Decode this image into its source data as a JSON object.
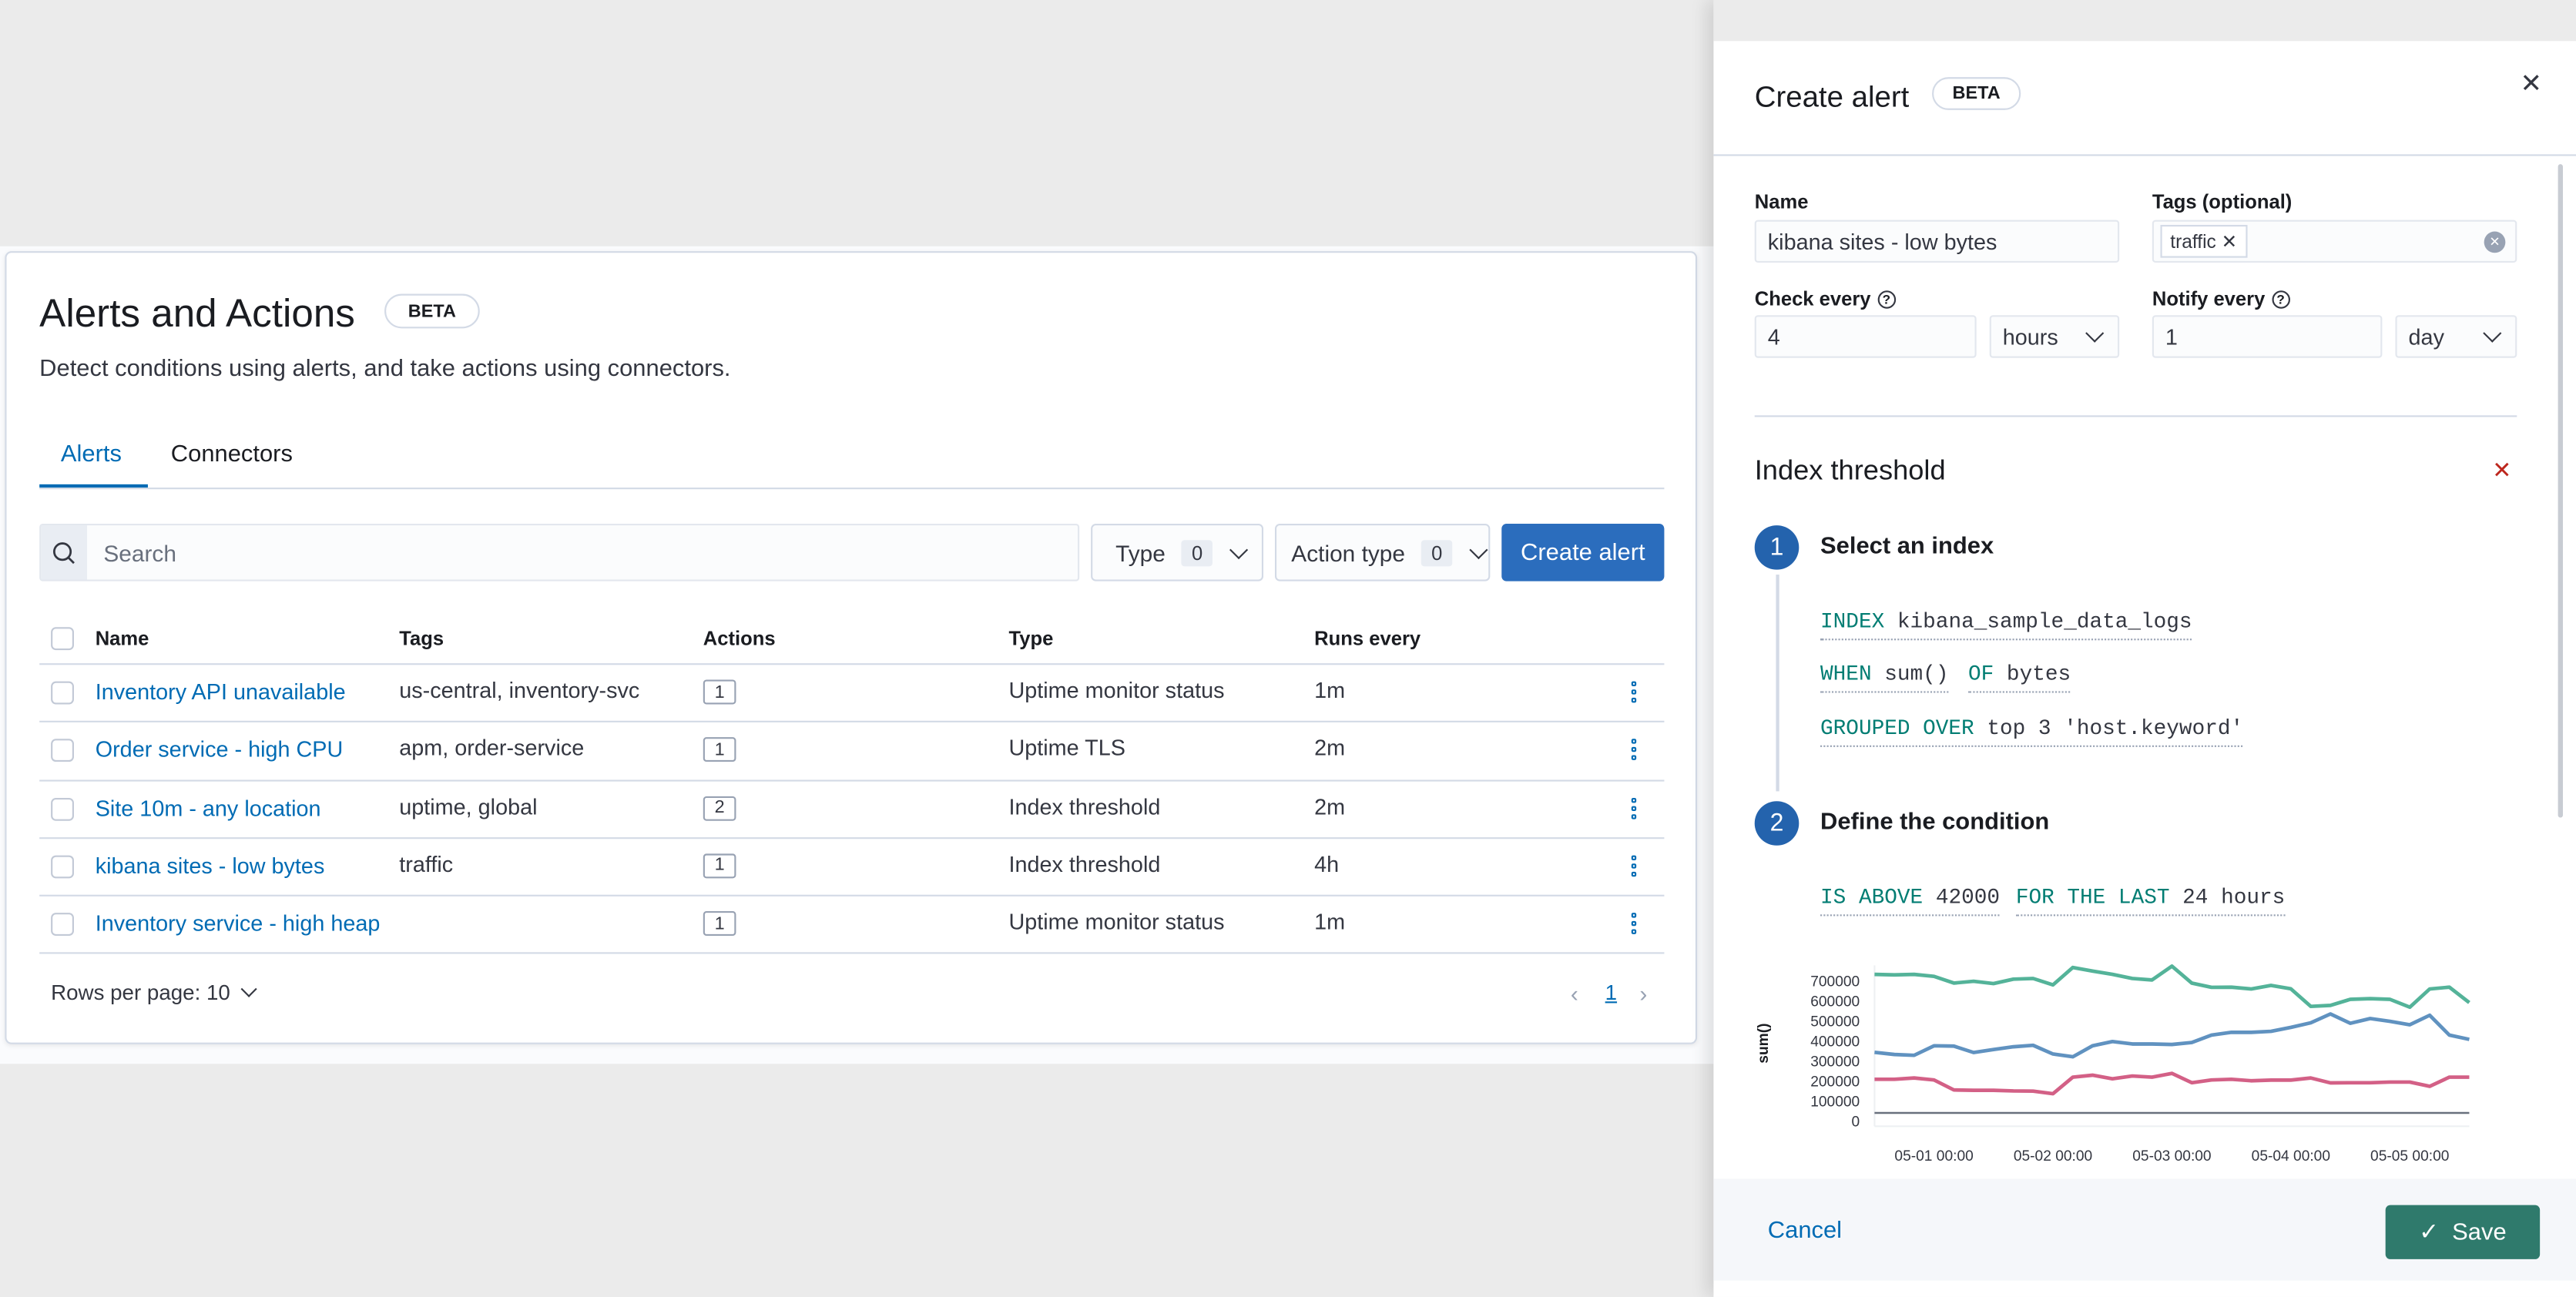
{
  "page": {
    "title": "Alerts and Actions",
    "badge": "BETA",
    "subtitle": "Detect conditions using alerts, and take actions using connectors.",
    "tabs": [
      {
        "label": "Alerts",
        "active": true
      },
      {
        "label": "Connectors",
        "active": false
      }
    ],
    "search_placeholder": "Search",
    "filters": [
      {
        "label": "Type",
        "count": "0"
      },
      {
        "label": "Action type",
        "count": "0"
      }
    ],
    "create_button": "Create alert",
    "columns": [
      "Name",
      "Tags",
      "Actions",
      "Type",
      "Runs every"
    ],
    "rows": [
      {
        "name": "Inventory API unavailable",
        "tags": "us-central, inventory-svc",
        "actions": "1",
        "type": "Uptime monitor status",
        "runs": "1m"
      },
      {
        "name": "Order service - high CPU",
        "tags": "apm, order-service",
        "actions": "1",
        "type": "Uptime TLS",
        "runs": "2m"
      },
      {
        "name": "Site 10m - any location",
        "tags": "uptime, global",
        "actions": "2",
        "type": "Index threshold",
        "runs": "2m"
      },
      {
        "name": "kibana sites - low bytes",
        "tags": "traffic",
        "actions": "1",
        "type": "Index threshold",
        "runs": "4h"
      },
      {
        "name": "Inventory service - high heap",
        "tags": "",
        "actions": "1",
        "type": "Uptime monitor status",
        "runs": "1m"
      }
    ],
    "rows_per_page": "Rows per page: 10",
    "current_page": "1"
  },
  "flyout": {
    "title": "Create alert",
    "badge": "BETA",
    "name_label": "Name",
    "name_value": "kibana sites - low bytes",
    "tags_label": "Tags (optional)",
    "tag": "traffic",
    "check_label": "Check every",
    "check_value": "4",
    "check_unit": "hours",
    "notify_label": "Notify every",
    "notify_value": "1",
    "notify_unit": "day",
    "section_title": "Index threshold",
    "step1": {
      "num": "1",
      "title": "Select an index"
    },
    "expr": {
      "index_kw": "INDEX",
      "index_val": "kibana_sample_data_logs",
      "when_kw": "WHEN",
      "when_val": "sum()",
      "of_kw": "OF",
      "of_val": "bytes",
      "group_kw": "GROUPED OVER",
      "group_val": "top 3 'host.keyword'"
    },
    "step2": {
      "num": "2",
      "title": "Define the condition"
    },
    "cond": {
      "above_kw": "IS ABOVE",
      "above_val": "42000",
      "last_kw": "FOR THE LAST",
      "last_val": "24 hours"
    },
    "cancel": "Cancel",
    "save": "Save"
  },
  "colors": {
    "accent": "#006bb4",
    "save": "#017d73",
    "series": [
      "#54b399",
      "#6092c0",
      "#d36086"
    ],
    "threshold": "#69707d"
  },
  "chart_data": {
    "type": "line",
    "ylabel": "sum()",
    "ylim": [
      0,
      780000
    ],
    "yticks": [
      "0",
      "100000",
      "200000",
      "300000",
      "400000",
      "500000",
      "600000",
      "700000"
    ],
    "xticks": [
      "05-01 00:00",
      "05-02 00:00",
      "05-03 00:00",
      "05-04 00:00",
      "05-05 00:00"
    ],
    "x_start": "04-30 12:00",
    "x_step_hours": 4,
    "threshold": 42000,
    "series": [
      {
        "values": [
          735000,
          732000,
          735000,
          725000,
          691000,
          700000,
          689000,
          711000,
          714000,
          682000,
          769000,
          751000,
          735000,
          714000,
          707000,
          776000,
          691000,
          670000,
          671000,
          662000,
          680000,
          663000,
          575000,
          580000,
          610000,
          613000,
          610000,
          571000,
          662000,
          671000,
          594000
        ]
      },
      {
        "values": [
          345000,
          334000,
          330000,
          378000,
          376000,
          344000,
          359000,
          373000,
          380000,
          337000,
          323000,
          378000,
          399000,
          387000,
          387000,
          384000,
          394000,
          431000,
          445000,
          445000,
          450000,
          470000,
          493000,
          537000,
          490000,
          514000,
          500000,
          483000,
          530000,
          431000,
          410000
        ]
      },
      {
        "values": [
          210000,
          210000,
          217000,
          207000,
          157000,
          155000,
          155000,
          152000,
          151000,
          138000,
          221000,
          231000,
          213000,
          227000,
          221000,
          240000,
          193000,
          207000,
          210000,
          203000,
          206000,
          206000,
          217000,
          192000,
          193000,
          193000,
          196000,
          196000,
          175000,
          221000,
          221000
        ]
      }
    ]
  }
}
